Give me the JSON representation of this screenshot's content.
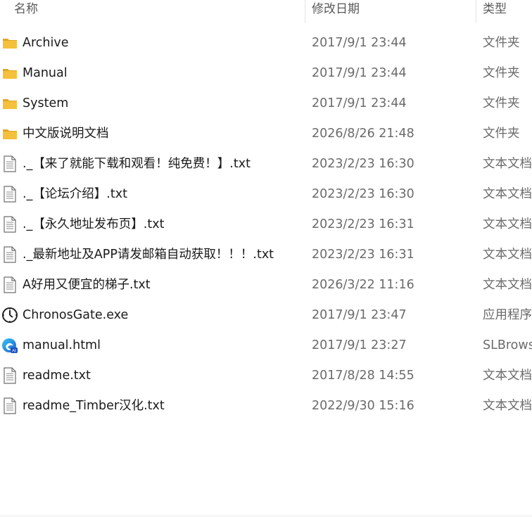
{
  "columns": {
    "name": "名称",
    "date": "修改日期",
    "type": "类型"
  },
  "files": [
    {
      "name": "Archive",
      "date": "2017/9/1 23:44",
      "type": "文件夹",
      "icon": "folder-icon"
    },
    {
      "name": "Manual",
      "date": "2017/9/1 23:44",
      "type": "文件夹",
      "icon": "folder-icon"
    },
    {
      "name": "System",
      "date": "2017/9/1 23:44",
      "type": "文件夹",
      "icon": "folder-icon"
    },
    {
      "name": "中文版说明文档",
      "date": "2026/8/26 21:48",
      "type": "文件夹",
      "icon": "folder-icon"
    },
    {
      "name": "._【来了就能下载和观看！纯免费！】.txt",
      "date": "2023/2/23 16:30",
      "type": "文本文档",
      "icon": "text-file-icon"
    },
    {
      "name": "._【论坛介绍】.txt",
      "date": "2023/2/23 16:30",
      "type": "文本文档",
      "icon": "text-file-icon"
    },
    {
      "name": "._【永久地址发布页】.txt",
      "date": "2023/2/23 16:31",
      "type": "文本文档",
      "icon": "text-file-icon"
    },
    {
      "name": "._最新地址及APP请发邮箱自动获取！！！.txt",
      "date": "2023/2/23 16:31",
      "type": "文本文档",
      "icon": "text-file-icon"
    },
    {
      "name": "A好用又便宜的梯子.txt",
      "date": "2026/3/22 11:16",
      "type": "文本文档",
      "icon": "text-file-icon"
    },
    {
      "name": "ChronosGate.exe",
      "date": "2017/9/1 23:47",
      "type": "应用程序",
      "icon": "clock-app-icon"
    },
    {
      "name": "manual.html",
      "date": "2017/9/1 23:27",
      "type": "SLBrowser",
      "icon": "browser-html-icon"
    },
    {
      "name": "readme.txt",
      "date": "2017/8/28 14:55",
      "type": "文本文档",
      "icon": "text-file-icon"
    },
    {
      "name": "readme_Timber汉化.txt",
      "date": "2022/9/30 15:16",
      "type": "文本文档",
      "icon": "text-file-icon"
    }
  ],
  "colors": {
    "folder": "#f5c03b",
    "folder_dark": "#e0a526",
    "text_primary": "#1a1a1a",
    "text_secondary": "#6b6b6b",
    "header_text": "#5a5a5a"
  }
}
